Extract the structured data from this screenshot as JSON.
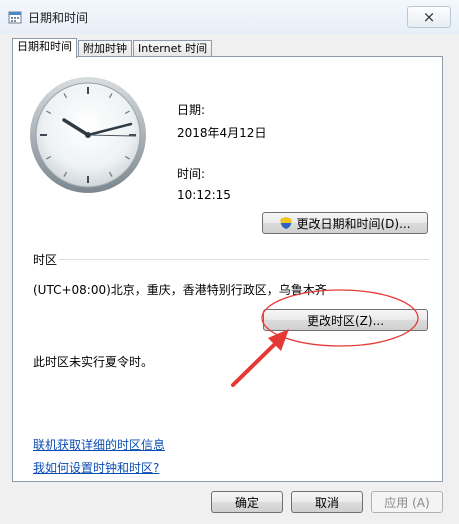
{
  "window": {
    "title": "日期和时间",
    "close_icon": "×"
  },
  "tabs": [
    {
      "label": "日期和时间",
      "active": true
    },
    {
      "label": "附加时钟"
    },
    {
      "label": "Internet 时间"
    }
  ],
  "datetime": {
    "date_label": "日期:",
    "date_value": "2018年4月12日",
    "time_label": "时间:",
    "time_value": "10:12:15",
    "change_datetime_button": "更改日期和时间(D)..."
  },
  "timezone": {
    "section_label": "时区",
    "current_zone": "(UTC+08:00)北京，重庆，香港特别行政区，乌鲁木齐",
    "change_zone_button": "更改时区(Z)...",
    "dst_note": "此时区未实行夏令时。"
  },
  "links": {
    "online_info": "联机获取详细的时区信息",
    "how_to_set": "我如何设置时钟和时区?"
  },
  "footer": {
    "ok": "确定",
    "cancel": "取消",
    "apply": "应用 (A)"
  },
  "annotation": {
    "color": "#e53935"
  },
  "icons": {
    "app": "calendar-clock-icon",
    "uac": "uac-shield-icon"
  }
}
